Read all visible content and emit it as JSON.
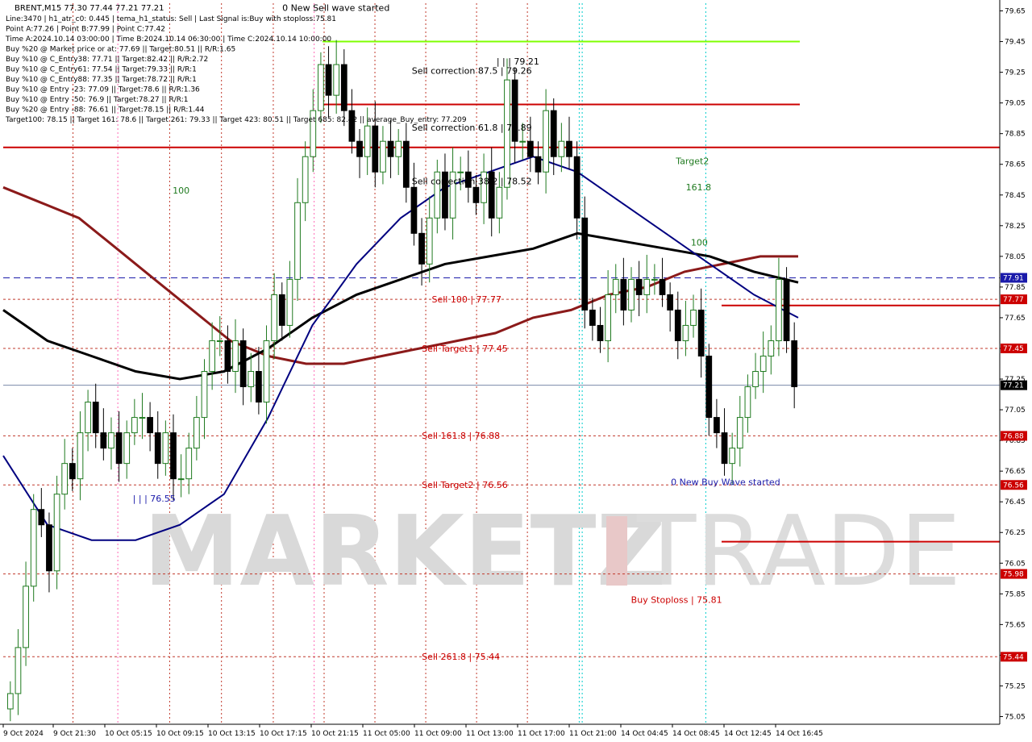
{
  "header": {
    "symbol_line": "BRENT,M15  77.30 77.44 77.21 77.21",
    "info_lines": [
      "Line:3470  | h1_atr_c0: 0.445  | tema_h1_status: Sell  | Last Signal is:Buy with stoploss:75.81",
      "Point A:77.26  | Point B:77.99  | Point C:77.42",
      "Time A:2024.10.14 03:00:00  | Time B:2024.10.14 06:30:00  | Time C:2024.10.14 10:00:00",
      "Buy %20 @ Market price or at: 77.69  || Target:80.51  || R/R:1.65",
      "Buy %10 @ C_Entry38: 77.71  || Target:82.42  || R/R:2.72",
      "Buy %10 @ C_Entry61: 77.54  || Target:79.33  || R/R:1",
      "Buy %10 @ C_Entry88: 77.35  || Target:78.72  || R/R:1",
      "Buy %10 @ Entry -23: 77.09  || Target:78.6  || R/R:1.36",
      "Buy %10 @ Entry -50: 76.9  || Target:78.27  || R/R:1",
      "Buy %20 @ Entry -88: 76.61  || Target:78.15  || R/R:1.44",
      "Target100: 78.15  || Target 161: 78.6  || Target 261: 79.33  || Target 423: 80.51  || Target 685: 82.42  || average_Buy_entry: 77.209"
    ]
  },
  "watermark": {
    "left": "MARKETZ",
    "right": "TRADE"
  },
  "colors": {
    "bg": "#ffffff",
    "bull": "#1f7a1f",
    "bear": "#000000",
    "red_level": "#cc0000",
    "dotted_level": "#c0392b",
    "blue_level": "#1a1aaa",
    "green_level": "#7fff00",
    "ma_dark_red": "#8b1a1a",
    "ma_black": "#000000",
    "ma_navy": "#000080",
    "current_price": "#000000",
    "buy_arrow": "#1a3fd6",
    "sell_arrow": "#e00000"
  },
  "chart_data": {
    "type": "candlestick",
    "title": "BRENT,M15",
    "ylim": [
      75.0,
      79.7
    ],
    "y_ticks": [
      79.65,
      79.45,
      79.25,
      79.05,
      78.85,
      78.65,
      78.45,
      78.25,
      78.05,
      77.85,
      77.65,
      77.45,
      77.25,
      77.05,
      76.85,
      76.65,
      76.45,
      76.25,
      76.05,
      75.85,
      75.65,
      75.45,
      75.25,
      75.05
    ],
    "x_labels": [
      "9 Oct 2024",
      "9 Oct 21:30",
      "10 Oct 05:15",
      "10 Oct 09:15",
      "10 Oct 13:15",
      "10 Oct 17:15",
      "10 Oct 21:15",
      "11 Oct 05:00",
      "11 Oct 09:00",
      "11 Oct 13:00",
      "11 Oct 17:00",
      "11 Oct 21:00",
      "14 Oct 04:45",
      "14 Oct 08:45",
      "14 Oct 12:45",
      "14 Oct 16:45"
    ],
    "current_price": 77.21,
    "series_close": [
      75.2,
      75.5,
      75.9,
      76.4,
      76.3,
      76.0,
      76.5,
      76.7,
      76.6,
      76.9,
      77.1,
      76.9,
      76.8,
      76.9,
      76.7,
      76.9,
      77.0,
      77.0,
      76.9,
      76.7,
      76.9,
      76.6,
      76.6,
      76.8,
      77.0,
      77.3,
      77.5,
      77.5,
      77.3,
      77.5,
      77.2,
      77.3,
      77.1,
      77.5,
      77.8,
      77.6,
      77.9,
      78.4,
      78.7,
      79.0,
      79.3,
      79.1,
      79.3,
      79.0,
      78.8,
      78.7,
      78.9,
      78.6,
      78.8,
      78.7,
      78.8,
      78.5,
      78.2,
      78.0,
      78.3,
      78.6,
      78.3,
      78.6,
      78.6,
      78.5,
      78.4,
      78.6,
      78.3,
      78.5,
      79.2,
      78.8,
      78.8,
      78.7,
      78.6,
      79.0,
      78.7,
      78.8,
      78.7,
      78.3,
      77.7,
      77.6,
      77.5,
      77.8,
      77.9,
      77.7,
      77.9,
      77.8,
      77.9,
      77.9,
      77.8,
      77.7,
      77.5,
      77.6,
      77.7,
      77.4,
      77.0,
      76.9,
      76.7,
      76.8,
      77.0,
      77.2,
      77.3,
      77.4,
      77.5,
      77.9,
      77.5,
      77.2
    ],
    "levels": [
      {
        "price": 79.45,
        "label": "",
        "style": "green"
      },
      {
        "price": 79.04,
        "label": "",
        "style": "red"
      },
      {
        "price": 78.76,
        "label": "",
        "style": "red"
      },
      {
        "price": 77.91,
        "label": "77.91",
        "style": "blue_dashed"
      },
      {
        "price": 77.77,
        "label": "77.77",
        "style": "red_dotted"
      },
      {
        "price": 77.73,
        "label": "",
        "style": "red_short"
      },
      {
        "price": 77.45,
        "label": "77.45",
        "style": "red_dotted"
      },
      {
        "price": 76.88,
        "label": "76.88",
        "style": "red_dotted"
      },
      {
        "price": 76.56,
        "label": "76.56",
        "style": "red_dotted"
      },
      {
        "price": 76.19,
        "label": "",
        "style": "red_short"
      },
      {
        "price": 75.98,
        "label": "75.98",
        "style": "red_dotted"
      },
      {
        "price": 75.44,
        "label": "75.44",
        "style": "red_dotted"
      }
    ],
    "annotations": [
      {
        "text": "0 New Sell wave started",
        "x": 0.28,
        "price": 79.65,
        "color": "#000000"
      },
      {
        "text": "Sell correction 87.5 | 79.26",
        "x": 0.41,
        "price": 79.24,
        "color": "#000000"
      },
      {
        "text": "Sell correction 61.8 | 78.89",
        "x": 0.41,
        "price": 78.87,
        "color": "#000000"
      },
      {
        "text": "Sell correction 38.2 | 78.52",
        "x": 0.41,
        "price": 78.52,
        "color": "#000000"
      },
      {
        "text": "| | | 79.21",
        "x": 0.495,
        "price": 79.3,
        "color": "#000000"
      },
      {
        "text": "Sell 100 | 77.77",
        "x": 0.43,
        "price": 77.75,
        "color": "#cc0000"
      },
      {
        "text": "Sell Target1 | 77.45",
        "x": 0.42,
        "price": 77.43,
        "color": "#cc0000"
      },
      {
        "text": "Sell 161.8 | 76.88",
        "x": 0.42,
        "price": 76.86,
        "color": "#cc0000"
      },
      {
        "text": "Sell Target2 | 76.56",
        "x": 0.42,
        "price": 76.54,
        "color": "#cc0000"
      },
      {
        "text": "Sell 261.8 | 75.44",
        "x": 0.42,
        "price": 75.42,
        "color": "#cc0000"
      },
      {
        "text": "Buy Stoploss | 75.81",
        "x": 0.63,
        "price": 75.79,
        "color": "#cc0000"
      },
      {
        "text": "0 New Buy Wave started",
        "x": 0.67,
        "price": 76.56,
        "color": "#1a1aaa"
      },
      {
        "text": "| | | 76.55",
        "x": 0.13,
        "price": 76.45,
        "color": "#1a1aaa"
      },
      {
        "text": "Target2",
        "x": 0.675,
        "price": 78.65,
        "color": "#1f7a1f"
      },
      {
        "text": "161.8",
        "x": 0.685,
        "price": 78.48,
        "color": "#1f7a1f"
      },
      {
        "text": "100",
        "x": 0.17,
        "price": 78.46,
        "color": "#1f7a1f"
      },
      {
        "text": "100",
        "x": 0.69,
        "price": 78.12,
        "color": "#1f7a1f"
      }
    ],
    "price_badges": [
      {
        "price": 77.91,
        "text": "77.91",
        "color": "#1a1aaa"
      },
      {
        "price": 77.77,
        "text": "77.77",
        "color": "#cc0000"
      },
      {
        "price": 77.45,
        "text": "77.45",
        "color": "#cc0000"
      },
      {
        "price": 77.21,
        "text": "77.21",
        "color": "#000000"
      },
      {
        "price": 76.88,
        "text": "76.88",
        "color": "#cc0000"
      },
      {
        "price": 76.56,
        "text": "76.56",
        "color": "#cc0000"
      },
      {
        "price": 75.98,
        "text": "75.98",
        "color": "#cc0000"
      },
      {
        "price": 75.44,
        "text": "75.44",
        "color": "#cc0000"
      }
    ],
    "moving_averages": [
      {
        "name": "ma-dark-red",
        "color": "#8b1a1a",
        "values": [
          78.5,
          78.4,
          78.3,
          78.1,
          77.9,
          77.7,
          77.5,
          77.4,
          77.35,
          77.35,
          77.4,
          77.45,
          77.5,
          77.55,
          77.65,
          77.7,
          77.8,
          77.85,
          77.95,
          78.0,
          78.05,
          78.05
        ]
      },
      {
        "name": "ma-black",
        "color": "#000000",
        "values": [
          77.7,
          77.5,
          77.4,
          77.3,
          77.25,
          77.3,
          77.45,
          77.65,
          77.8,
          77.9,
          78.0,
          78.05,
          78.1,
          78.2,
          78.15,
          78.1,
          78.05,
          77.95,
          77.88
        ]
      },
      {
        "name": "ma-navy",
        "color": "#000080",
        "values": [
          76.75,
          76.3,
          76.2,
          76.2,
          76.3,
          76.5,
          77.0,
          77.6,
          78.0,
          78.3,
          78.5,
          78.6,
          78.7,
          78.6,
          78.4,
          78.2,
          78.0,
          77.8,
          77.65
        ]
      }
    ],
    "vertical_markers": [
      {
        "x": 0.07,
        "color": "#c0392b"
      },
      {
        "x": 0.115,
        "color": "#ff69b4"
      },
      {
        "x": 0.167,
        "color": "#c0392b"
      },
      {
        "x": 0.219,
        "color": "#c0392b"
      },
      {
        "x": 0.271,
        "color": "#c0392b"
      },
      {
        "x": 0.312,
        "color": "#ff69b4"
      },
      {
        "x": 0.322,
        "color": "#c0392b"
      },
      {
        "x": 0.373,
        "color": "#c0392b"
      },
      {
        "x": 0.424,
        "color": "#c0392b"
      },
      {
        "x": 0.475,
        "color": "#c0392b"
      },
      {
        "x": 0.526,
        "color": "#c0392b"
      },
      {
        "x": 0.578,
        "color": "#00cccc"
      },
      {
        "x": 0.581,
        "color": "#00cccc"
      },
      {
        "x": 0.705,
        "color": "#00cccc"
      }
    ]
  }
}
